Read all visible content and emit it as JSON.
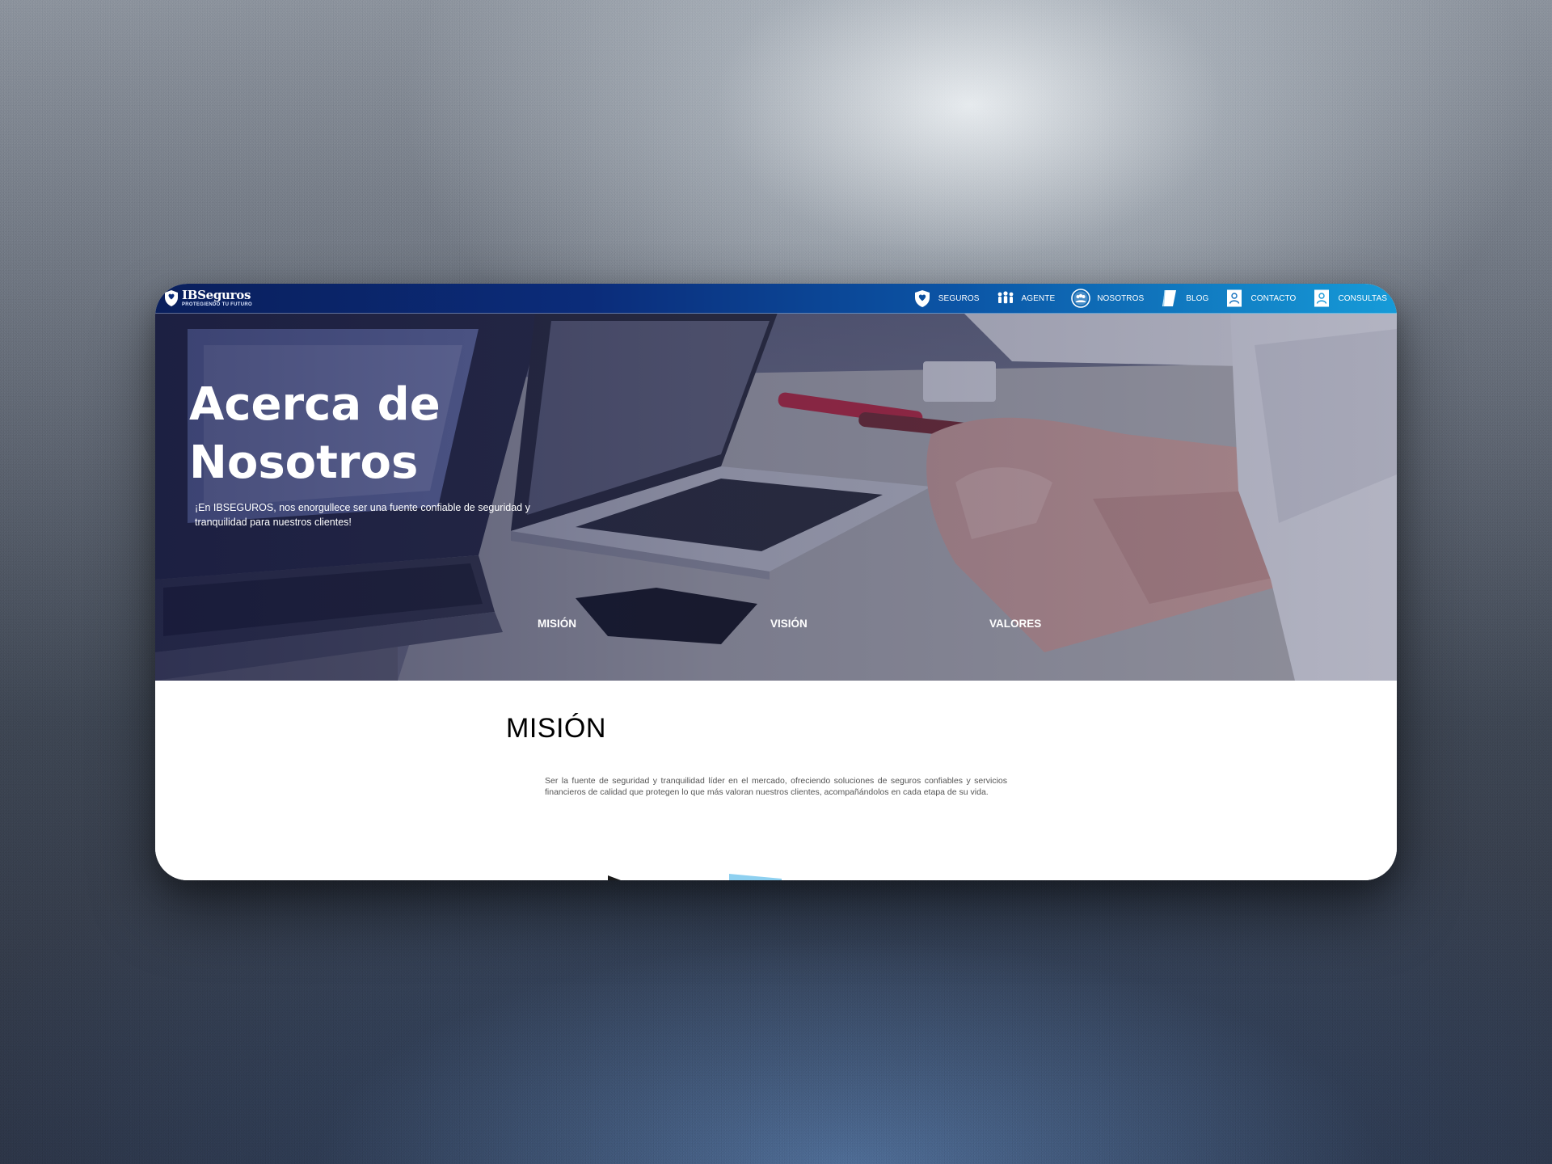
{
  "brand": {
    "name": "IBSeguros",
    "tagline": "PROTEGIENDO TU FUTURO"
  },
  "nav": {
    "items": [
      {
        "label": "SEGUROS",
        "icon": "shield-heart-icon"
      },
      {
        "label": "AGENTE",
        "icon": "people-group-icon"
      },
      {
        "label": "NOSOTROS",
        "icon": "team-circle-icon"
      },
      {
        "label": "BLOG",
        "icon": "book-icon"
      },
      {
        "label": "CONTACTO",
        "icon": "user-card-icon"
      },
      {
        "label": "CONSULTAS",
        "icon": "user-card-icon"
      }
    ]
  },
  "hero": {
    "title": "Acerca de Nosotros",
    "subtitle": "¡En IBSEGUROS, nos enorgullece ser una fuente confiable de seguridad y tranquilidad para nuestros clientes!",
    "tabs": [
      "MISIÓN",
      "VISIÓN",
      "VALORES"
    ]
  },
  "section": {
    "title": "MISIÓN",
    "body": "Ser la fuente de seguridad y tranquilidad líder en el mercado, ofreciendo soluciones de seguros confiables y servicios financieros de calidad que protegen lo que más valoran nuestros clientes, acompañándolos en cada etapa de su vida."
  },
  "colors": {
    "nav_start": "#0a1f5c",
    "nav_end": "#169bd8",
    "hero_overlay": "#141846"
  }
}
